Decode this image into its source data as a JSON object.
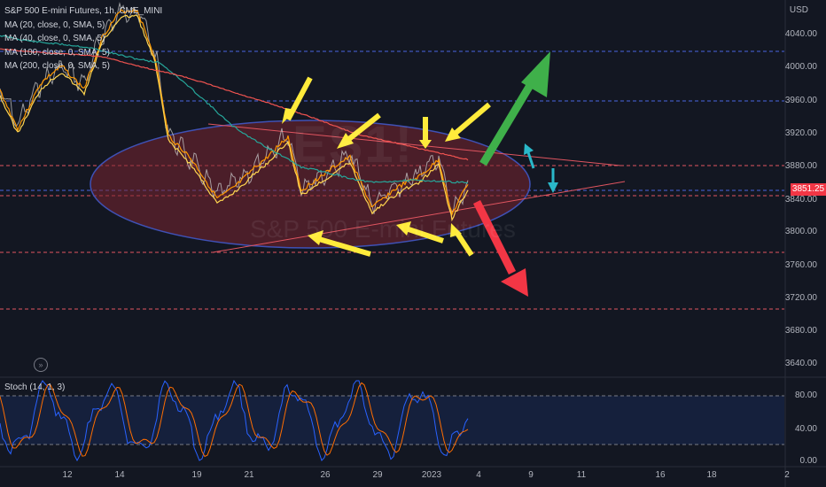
{
  "header": {
    "symbol_line": "S&P 500 E-mini Futures, 1h, CME_MINI",
    "indicators": [
      "MA (20, close, 0, SMA, 5)",
      "MA (40, close, 0, SMA, 5)",
      "MA (100, close, 0, SMA, 5)",
      "MA (200, close, 0, SMA, 5)"
    ]
  },
  "price_axis": {
    "currency": "USD",
    "ticks": [
      "4040.00",
      "4000.00",
      "3960.00",
      "3920.00",
      "3880.00",
      "3840.00",
      "3800.00",
      "3760.00",
      "3720.00",
      "3680.00",
      "3640.00"
    ],
    "current_price": "3851.25"
  },
  "time_axis": {
    "labels": [
      "12",
      "14",
      "19",
      "21",
      "26",
      "29",
      "2023",
      "4",
      "9",
      "11",
      "16",
      "18",
      "2"
    ]
  },
  "watermark": {
    "symbol": "ES1!",
    "name": "S&P 500 E-mini Futures"
  },
  "stoch": {
    "label": "Stoch (14, 1, 3)",
    "ticks": [
      "80.00",
      "40.00",
      "0.00"
    ]
  },
  "colors": {
    "background": "#131722",
    "up_arrow": "#3fb04a",
    "down_arrow": "#f23645",
    "annotation_arrow": "#ffeb3b",
    "cyan_arrow": "#2ab8c9",
    "ellipse_fill": "#7a2430",
    "ellipse_stroke": "#3f51b5"
  }
}
